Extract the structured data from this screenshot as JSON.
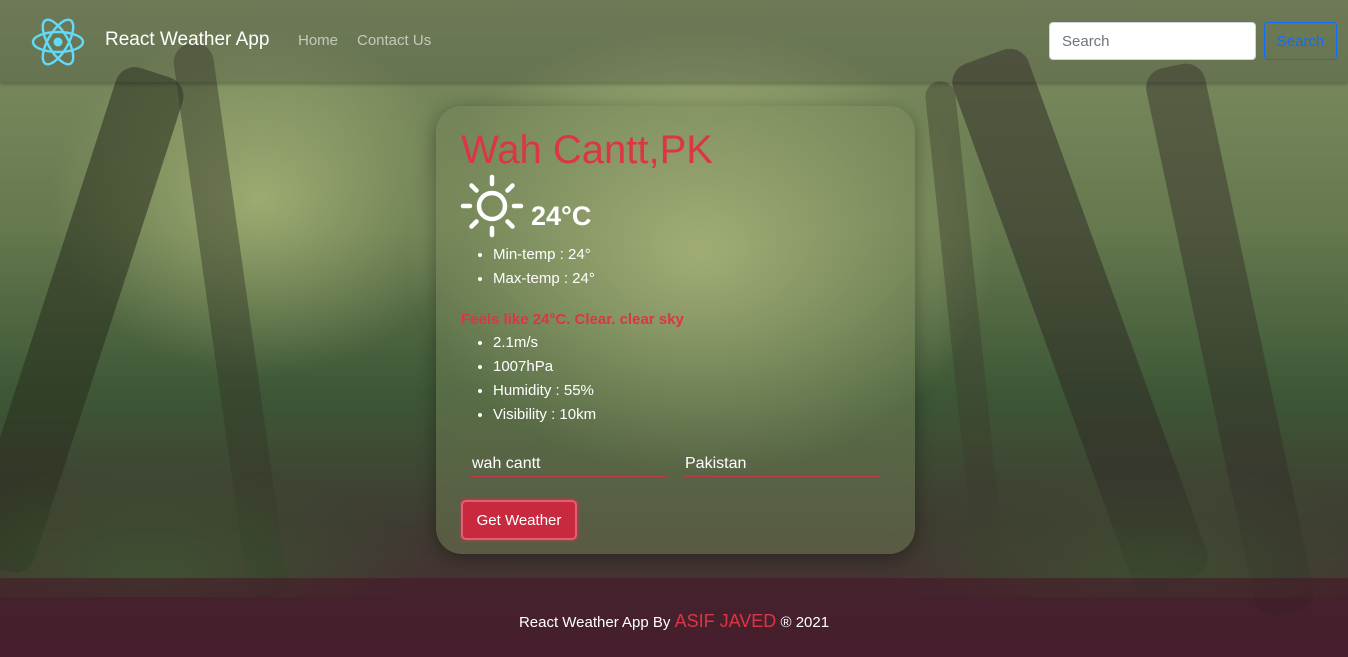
{
  "navbar": {
    "brand": "React Weather App",
    "links": [
      "Home",
      "Contact Us"
    ],
    "search": {
      "placeholder": "Search",
      "button_label": "Search"
    }
  },
  "weather": {
    "city": "Wah Cantt,PK",
    "icon": "sun-icon",
    "temperature": "24°C",
    "temps": [
      "Min-temp :  24°",
      "Max-temp :  24°"
    ],
    "feels_like": "Feels like 24°C. Clear. clear sky",
    "details": [
      "2.1m/s",
      "1007hPa",
      "Humidity : 55%",
      "Visibility : 10km"
    ]
  },
  "form": {
    "city_value": "wah cantt",
    "country_value": "Pakistan",
    "submit_label": "Get Weather"
  },
  "footer": {
    "prefix": "React Weather App By",
    "author": "ASIF JAVED",
    "suffix": "® 2021"
  },
  "colors": {
    "accent": "#dc3545",
    "search_button": "#0d6efd",
    "logo": "#61dafb"
  }
}
